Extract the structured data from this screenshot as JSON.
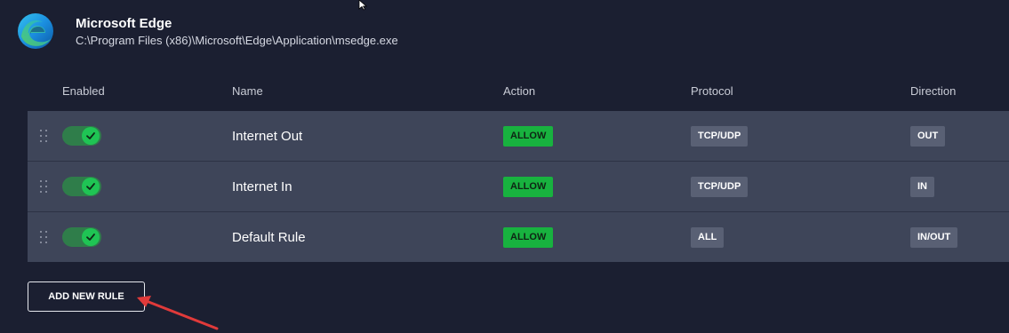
{
  "app": {
    "name": "Microsoft Edge",
    "path": "C:\\Program Files (x86)\\Microsoft\\Edge\\Application\\msedge.exe",
    "icon": "microsoft-edge-logo"
  },
  "columns": {
    "enabled": "Enabled",
    "name": "Name",
    "action": "Action",
    "protocol": "Protocol",
    "direction": "Direction"
  },
  "rules": [
    {
      "enabled": true,
      "name": "Internet Out",
      "action": "ALLOW",
      "protocol": "TCP/UDP",
      "direction": "OUT"
    },
    {
      "enabled": true,
      "name": "Internet In",
      "action": "ALLOW",
      "protocol": "TCP/UDP",
      "direction": "IN"
    },
    {
      "enabled": true,
      "name": "Default Rule",
      "action": "ALLOW",
      "protocol": "ALL",
      "direction": "IN/OUT"
    }
  ],
  "add_rule_label": "ADD NEW RULE",
  "colors": {
    "background": "#1b1f31",
    "row": "#3e4559",
    "allow": "#18b23f",
    "toggle_on": "#1fc454",
    "annotation_arrow": "#e03a3a"
  }
}
